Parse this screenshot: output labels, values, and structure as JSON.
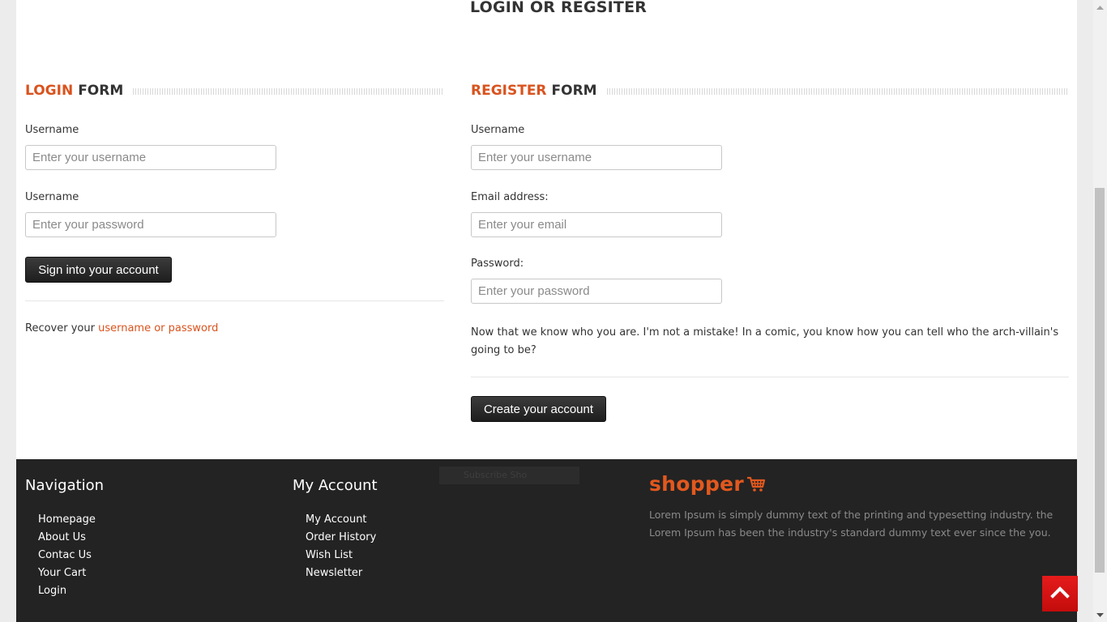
{
  "page": {
    "title": "LOGIN OR REGSITER"
  },
  "login": {
    "heading_accent": "LOGIN",
    "heading_rest": "FORM",
    "username_label": "Username",
    "username_placeholder": "Enter your username",
    "password_label": "Username",
    "password_placeholder": "Enter your password",
    "submit_label": "Sign into your account",
    "recover_prefix": "Recover your",
    "recover_link": "username or password"
  },
  "register": {
    "heading_accent": "REGISTER",
    "heading_rest": "FORM",
    "username_label": "Username",
    "username_placeholder": "Enter your username",
    "email_label": "Email address:",
    "email_placeholder": "Enter your email",
    "password_label": "Password:",
    "password_placeholder": "Enter your password",
    "note": "Now that we know who you are. I'm not a mistake! In a comic, you know how you can tell who the arch-villain's going to be?",
    "submit_label": "Create your account"
  },
  "footer": {
    "navigation": {
      "heading": "Navigation",
      "items": [
        "Homepage",
        "About Us",
        "Contac Us",
        "Your Cart",
        "Login"
      ]
    },
    "my_account": {
      "heading": "My Account",
      "items": [
        "My Account",
        "Order History",
        "Wish List",
        "Newsletter"
      ]
    },
    "subscribe_label": "Subscribe Sho",
    "logo_text": "shopper",
    "about": "Lorem Ipsum is simply dummy text of the printing and typesetting industry. the Lorem Ipsum has been the industry's standard dummy text ever since the you."
  },
  "icons": {
    "cart": "shopping-cart-icon",
    "scroll_top": "chevron-up-icon"
  },
  "colors": {
    "accent": "#d9531e",
    "footer_bg": "#232323",
    "scroll_top_bg": "#e51b1b",
    "button_bg": "#2b2b2b"
  }
}
